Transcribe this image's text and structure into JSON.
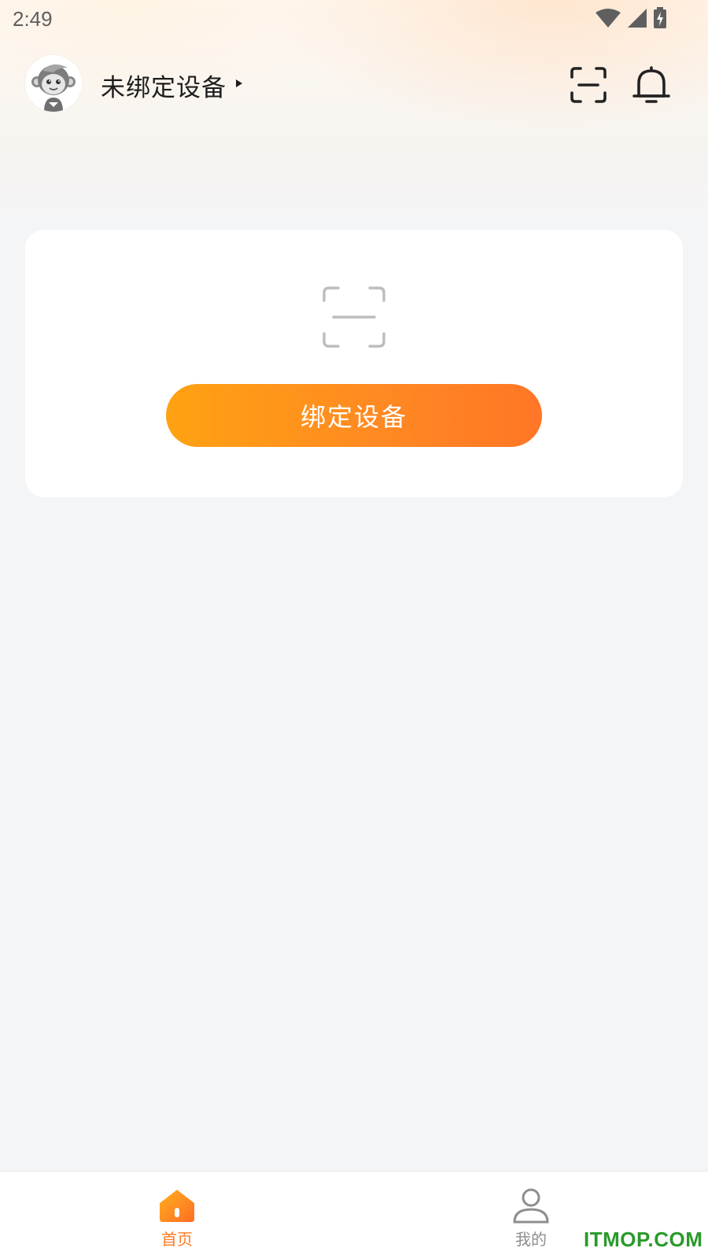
{
  "status_bar": {
    "time": "2:49",
    "icons": [
      "wifi-icon",
      "signal-icon",
      "battery-charging-icon"
    ]
  },
  "header": {
    "avatar_icon": "monkey-avatar-icon",
    "device_title": "未绑定设备",
    "caret_icon": "caret-right-icon",
    "scan_icon": "scan-icon",
    "bell_icon": "bell-icon"
  },
  "bind_card": {
    "placeholder_icon": "scan-icon",
    "bind_button_label": "绑定设备"
  },
  "bottom_nav": {
    "items": [
      {
        "label": "首页",
        "icon": "home-icon",
        "active": true
      },
      {
        "label": "我的",
        "icon": "user-icon",
        "active": false
      }
    ]
  },
  "colors": {
    "accent_start": "#FFA211",
    "accent_end": "#FF7626",
    "active_tab": "#FF7A22",
    "background": "#F4F5F7"
  },
  "watermark": "ITMOP.COM"
}
